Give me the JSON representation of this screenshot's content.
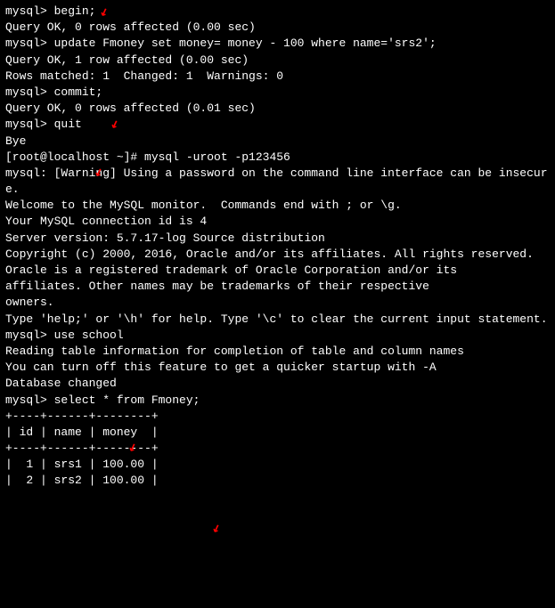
{
  "lines": {
    "l1_prompt": "mysql> ",
    "l1_cmd": "begin;",
    "l2": "Query OK, 0 rows affected (0.00 sec)",
    "l3": "",
    "l4_prompt": "mysql> ",
    "l4_cmd": "update Fmoney set money= money - 100 where name='srs2';",
    "l5": "Query OK, 1 row affected (0.00 sec)",
    "l6": "Rows matched: 1  Changed: 1  Warnings: 0",
    "l7": "",
    "l8_prompt": "mysql> ",
    "l8_cmd": "commit;",
    "l9": "Query OK, 0 rows affected (0.01 sec)",
    "l10": "",
    "l11_prompt": "mysql> ",
    "l11_cmd": "quit",
    "l12": "Bye",
    "l13_prompt": "[root@localhost ~]# ",
    "l13_cmd": "mysql -uroot -p123456",
    "l14": "mysql: [Warning] Using a password on the command line interface can be insecure.",
    "l15": "Welcome to the MySQL monitor.  Commands end with ; or \\g.",
    "l16": "Your MySQL connection id is 4",
    "l17": "Server version: 5.7.17-log Source distribution",
    "l18": "",
    "l19": "Copyright (c) 2000, 2016, Oracle and/or its affiliates. All rights reserved.",
    "l20": "",
    "l21": "Oracle is a registered trademark of Oracle Corporation and/or its",
    "l22": "affiliates. Other names may be trademarks of their respective",
    "l23": "owners.",
    "l24": "",
    "l25": "Type 'help;' or '\\h' for help. Type '\\c' to clear the current input statement.",
    "l26": "",
    "l27_prompt": "mysql> ",
    "l27_cmd": "use school",
    "l28": "Reading table information for completion of table and column names",
    "l29": "You can turn off this feature to get a quicker startup with -A",
    "l30": "",
    "l31": "Database changed",
    "l32_prompt": "mysql> ",
    "l32_cmd": "select * from Fmoney;",
    "l33": "+----+------+--------+",
    "l34": "| id | name | money  |",
    "l35": "+----+------+--------+",
    "l36": "|  1 | srs1 | 100.00 |",
    "l37": "|  2 | srs2 | 100.00 |"
  },
  "arrows": {
    "a1": "↙",
    "a2": "↙",
    "a3": "↙",
    "a4": "↙",
    "a5": "↙",
    "a6": "↙"
  },
  "chart_data": {
    "type": "table",
    "title": "Fmoney",
    "columns": [
      "id",
      "name",
      "money"
    ],
    "rows": [
      {
        "id": 1,
        "name": "srs1",
        "money": 100.0
      },
      {
        "id": 2,
        "name": "srs2",
        "money": 100.0
      }
    ]
  }
}
